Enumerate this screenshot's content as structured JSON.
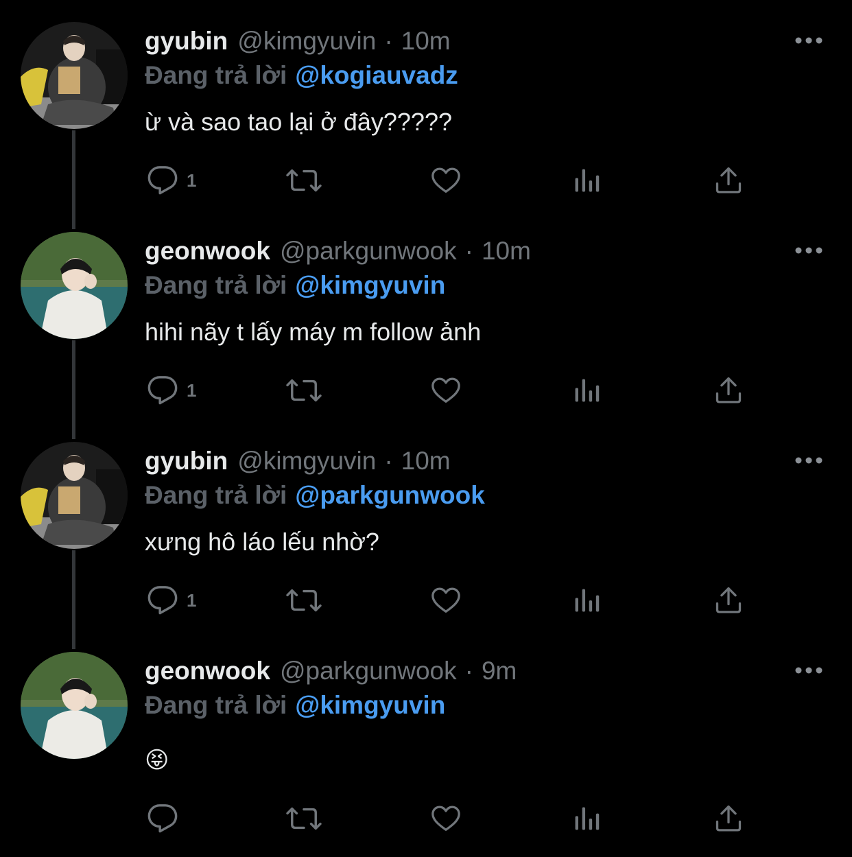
{
  "theme": {
    "background": "#000000",
    "text_primary": "#e7e9ea",
    "text_secondary": "#71767b",
    "mention_color": "#4a9cf0",
    "thread_line": "#333639"
  },
  "reply_prefix": "Đang trả lời",
  "tweets": [
    {
      "display_name": "gyubin",
      "handle": "@kimgyuvin",
      "dot": "·",
      "time": "10m",
      "reply_to": "@kogiauvadz",
      "text": "ừ và sao tao lại ở đây?????",
      "reply_count": "1",
      "avatar": "gyubin-avatar"
    },
    {
      "display_name": "geonwook",
      "handle": "@parkgunwook",
      "dot": "·",
      "time": "10m",
      "reply_to": "@kimgyuvin",
      "text": "hihi nãy t lấy máy m follow ảnh",
      "reply_count": "1",
      "avatar": "geonwook-avatar"
    },
    {
      "display_name": "gyubin",
      "handle": "@kimgyuvin",
      "dot": "·",
      "time": "10m",
      "reply_to": "@parkgunwook",
      "text": "xưng hô láo lếu nhờ?",
      "reply_count": "1",
      "avatar": "gyubin-avatar"
    },
    {
      "display_name": "geonwook",
      "handle": "@parkgunwook",
      "dot": "·",
      "time": "9m",
      "reply_to": "@kimgyuvin",
      "text": "😝",
      "reply_count": "",
      "avatar": "geonwook-avatar"
    }
  ]
}
